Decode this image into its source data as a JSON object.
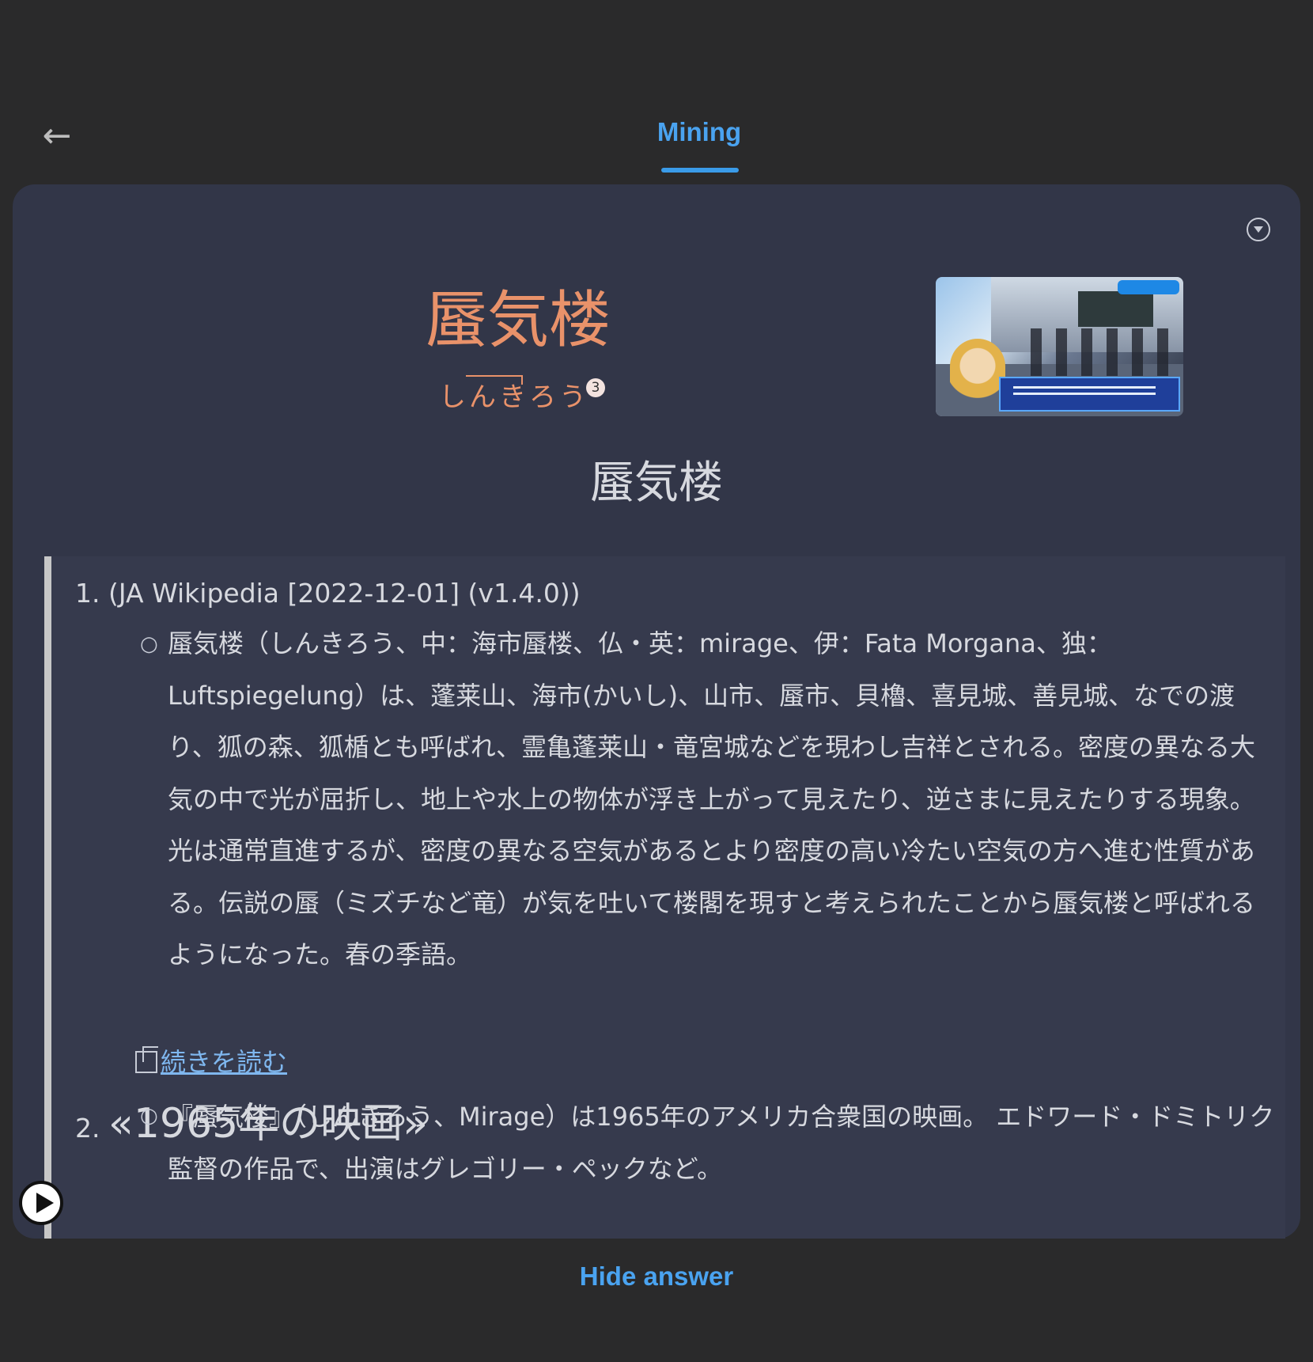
{
  "header": {
    "back_icon": "arrow-left-icon",
    "tab_label": "Mining"
  },
  "card": {
    "menu_icon": "dropdown-circle-icon",
    "term": "蜃気楼",
    "reading": "しんきろう",
    "frequency": "3",
    "headword": "蜃気楼",
    "screenshot_caption": ""
  },
  "glossary": {
    "entry1": {
      "number": "1.",
      "source": "(JA Wikipedia [2022-12-01] (v1.4.0))",
      "text": "蜃気楼（しんきろう、中：海市蜃楼、仏・英：mirage、伊：Fata Morgana、独：Luftspiegelung）は、蓬莱山、海市(かいし)、山市、蜃市、貝櫓、喜見城、善見城、なでの渡り、狐の森、狐楯とも呼ばれ、霊亀蓬莱山・竜宮城などを現わし吉祥とされる。密度の異なる大気の中で光が屈折し、地上や水上の物体が浮き上がって見えたり、逆さまに見えたりする現象。光は通常直進するが、密度の異なる空気があるとより密度の高い冷たい空気の方へ進む性質がある。伝説の蜃（ミズチなど竜）が気を吐いて楼閣を現すと考えられたことから蜃気楼と呼ばれるようになった。春の季語。",
      "read_more": "続きを読む"
    },
    "entry2": {
      "number": "2.",
      "title": "«1965年の映画»",
      "text": "『蜃気楼』（しんきろう、Mirage）は1965年のアメリカ合衆国の映画。 エドワード・ドミトリク監督の作品で、出演はグレゴリー・ペックなど。"
    }
  },
  "controls": {
    "play_icon": "play-icon",
    "hide_answer": "Hide answer"
  }
}
